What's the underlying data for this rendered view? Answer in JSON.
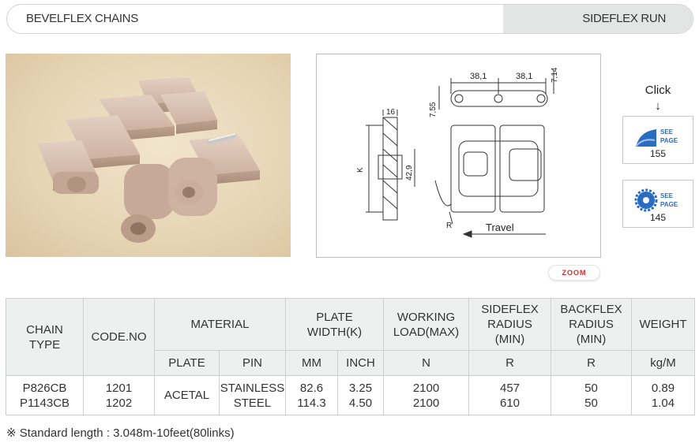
{
  "header": {
    "left_title": "BEVELFLEX CHAINS",
    "right_tab": "SIDEFLEX RUN"
  },
  "drawing": {
    "dim_pitch_1": "38,1",
    "dim_pitch_2": "38,1",
    "dim_7_14": "7,14",
    "dim_7_55": "7,55",
    "dim_16": "16",
    "dim_k": "K",
    "dim_42_9": "42,9",
    "dim_r": "R",
    "travel_label": "Travel"
  },
  "zoom_label": "ZOOM",
  "click": {
    "label": "Click",
    "arrow": "↓"
  },
  "see_page_cards": [
    {
      "icon": "see-page-wave-icon",
      "line1": "SEE",
      "line2": "PAGE",
      "page": "155"
    },
    {
      "icon": "see-page-gear-icon",
      "line1": "SEE",
      "line2": "PAGE",
      "page": "145"
    }
  ],
  "table": {
    "headers": {
      "chain_type": [
        "CHAIN",
        "TYPE"
      ],
      "code_no": "CODE.NO",
      "material": "MATERIAL",
      "plate_width": [
        "PLATE",
        "WIDTH(K)"
      ],
      "working_load": [
        "WORKING",
        "LOAD(MAX)"
      ],
      "sideflex_radius": [
        "SIDEFLEX",
        "RADIUS",
        "(MIN)"
      ],
      "backflex_radius": [
        "BACKFLEX",
        "RADIUS",
        "(MIN)"
      ],
      "weight": "WEIGHT"
    },
    "subheaders": {
      "plate": "PLATE",
      "pin": "PIN",
      "mm": "MM",
      "inch": "INCH",
      "load_unit": "N",
      "sideflex_unit": "R",
      "backflex_unit": "R",
      "weight_unit": "kg/M"
    },
    "rows": [
      {
        "chain_type": [
          "P826CB",
          "P1143CB"
        ],
        "code_no": [
          "1201",
          "1202"
        ],
        "plate": "ACETAL",
        "pin": [
          "STAINLESS",
          "STEEL"
        ],
        "mm": [
          "82.6",
          "114.3"
        ],
        "inch": [
          "3.25",
          "4.50"
        ],
        "working_load": [
          "2100",
          "2100"
        ],
        "sideflex_radius": [
          "457",
          "610"
        ],
        "backflex_radius": [
          "50",
          "50"
        ],
        "weight": [
          "0.89",
          "1.04"
        ]
      }
    ]
  },
  "note": "※ Standard length : 3.048m-10feet(80links)",
  "colors": {
    "header_tab_bg": "#e2e5e3",
    "table_header_bg": "#eef0ef",
    "chain_color": "#d8bfae",
    "photo_bg": "#e6d4b3",
    "zoom_text": "#d32a2a",
    "see_page_blue": "#2a6cc2"
  }
}
